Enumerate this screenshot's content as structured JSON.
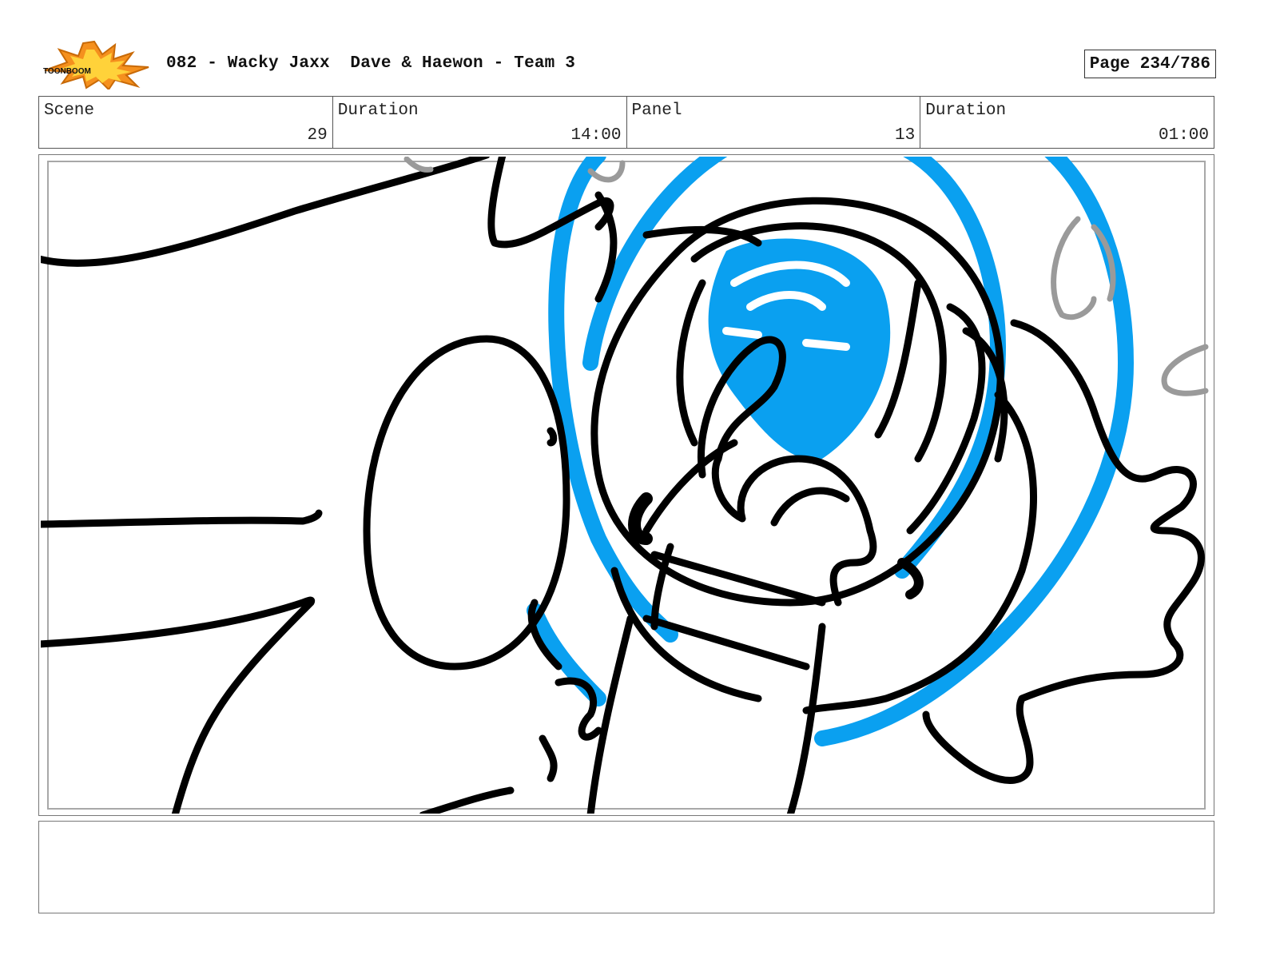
{
  "header": {
    "logo_text": "TOONBOOM",
    "title": "082 - Wacky Jaxx  Dave & Haewon - Team 3",
    "page": "Page 234/786"
  },
  "info": {
    "scene_label": "Scene",
    "scene_value": "29",
    "scene_duration_label": "Duration",
    "scene_duration_value": "14:00",
    "panel_label": "Panel",
    "panel_value": "13",
    "panel_duration_label": "Duration",
    "panel_duration_value": "01:00"
  },
  "colors": {
    "accent_blue": "#0aa0f0",
    "ink": "#000000",
    "sketch_gray": "#9a9a9a",
    "logo_orange": "#f5901e"
  },
  "notes": {
    "text": ""
  }
}
